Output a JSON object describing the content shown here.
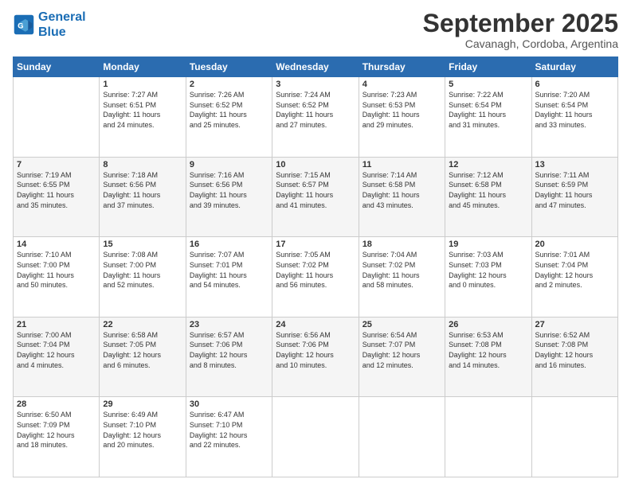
{
  "header": {
    "logo_line1": "General",
    "logo_line2": "Blue",
    "month": "September 2025",
    "location": "Cavanagh, Cordoba, Argentina"
  },
  "weekdays": [
    "Sunday",
    "Monday",
    "Tuesday",
    "Wednesday",
    "Thursday",
    "Friday",
    "Saturday"
  ],
  "weeks": [
    [
      {
        "day": "",
        "info": ""
      },
      {
        "day": "1",
        "info": "Sunrise: 7:27 AM\nSunset: 6:51 PM\nDaylight: 11 hours\nand 24 minutes."
      },
      {
        "day": "2",
        "info": "Sunrise: 7:26 AM\nSunset: 6:52 PM\nDaylight: 11 hours\nand 25 minutes."
      },
      {
        "day": "3",
        "info": "Sunrise: 7:24 AM\nSunset: 6:52 PM\nDaylight: 11 hours\nand 27 minutes."
      },
      {
        "day": "4",
        "info": "Sunrise: 7:23 AM\nSunset: 6:53 PM\nDaylight: 11 hours\nand 29 minutes."
      },
      {
        "day": "5",
        "info": "Sunrise: 7:22 AM\nSunset: 6:54 PM\nDaylight: 11 hours\nand 31 minutes."
      },
      {
        "day": "6",
        "info": "Sunrise: 7:20 AM\nSunset: 6:54 PM\nDaylight: 11 hours\nand 33 minutes."
      }
    ],
    [
      {
        "day": "7",
        "info": "Sunrise: 7:19 AM\nSunset: 6:55 PM\nDaylight: 11 hours\nand 35 minutes."
      },
      {
        "day": "8",
        "info": "Sunrise: 7:18 AM\nSunset: 6:56 PM\nDaylight: 11 hours\nand 37 minutes."
      },
      {
        "day": "9",
        "info": "Sunrise: 7:16 AM\nSunset: 6:56 PM\nDaylight: 11 hours\nand 39 minutes."
      },
      {
        "day": "10",
        "info": "Sunrise: 7:15 AM\nSunset: 6:57 PM\nDaylight: 11 hours\nand 41 minutes."
      },
      {
        "day": "11",
        "info": "Sunrise: 7:14 AM\nSunset: 6:58 PM\nDaylight: 11 hours\nand 43 minutes."
      },
      {
        "day": "12",
        "info": "Sunrise: 7:12 AM\nSunset: 6:58 PM\nDaylight: 11 hours\nand 45 minutes."
      },
      {
        "day": "13",
        "info": "Sunrise: 7:11 AM\nSunset: 6:59 PM\nDaylight: 11 hours\nand 47 minutes."
      }
    ],
    [
      {
        "day": "14",
        "info": "Sunrise: 7:10 AM\nSunset: 7:00 PM\nDaylight: 11 hours\nand 50 minutes."
      },
      {
        "day": "15",
        "info": "Sunrise: 7:08 AM\nSunset: 7:00 PM\nDaylight: 11 hours\nand 52 minutes."
      },
      {
        "day": "16",
        "info": "Sunrise: 7:07 AM\nSunset: 7:01 PM\nDaylight: 11 hours\nand 54 minutes."
      },
      {
        "day": "17",
        "info": "Sunrise: 7:05 AM\nSunset: 7:02 PM\nDaylight: 11 hours\nand 56 minutes."
      },
      {
        "day": "18",
        "info": "Sunrise: 7:04 AM\nSunset: 7:02 PM\nDaylight: 11 hours\nand 58 minutes."
      },
      {
        "day": "19",
        "info": "Sunrise: 7:03 AM\nSunset: 7:03 PM\nDaylight: 12 hours\nand 0 minutes."
      },
      {
        "day": "20",
        "info": "Sunrise: 7:01 AM\nSunset: 7:04 PM\nDaylight: 12 hours\nand 2 minutes."
      }
    ],
    [
      {
        "day": "21",
        "info": "Sunrise: 7:00 AM\nSunset: 7:04 PM\nDaylight: 12 hours\nand 4 minutes."
      },
      {
        "day": "22",
        "info": "Sunrise: 6:58 AM\nSunset: 7:05 PM\nDaylight: 12 hours\nand 6 minutes."
      },
      {
        "day": "23",
        "info": "Sunrise: 6:57 AM\nSunset: 7:06 PM\nDaylight: 12 hours\nand 8 minutes."
      },
      {
        "day": "24",
        "info": "Sunrise: 6:56 AM\nSunset: 7:06 PM\nDaylight: 12 hours\nand 10 minutes."
      },
      {
        "day": "25",
        "info": "Sunrise: 6:54 AM\nSunset: 7:07 PM\nDaylight: 12 hours\nand 12 minutes."
      },
      {
        "day": "26",
        "info": "Sunrise: 6:53 AM\nSunset: 7:08 PM\nDaylight: 12 hours\nand 14 minutes."
      },
      {
        "day": "27",
        "info": "Sunrise: 6:52 AM\nSunset: 7:08 PM\nDaylight: 12 hours\nand 16 minutes."
      }
    ],
    [
      {
        "day": "28",
        "info": "Sunrise: 6:50 AM\nSunset: 7:09 PM\nDaylight: 12 hours\nand 18 minutes."
      },
      {
        "day": "29",
        "info": "Sunrise: 6:49 AM\nSunset: 7:10 PM\nDaylight: 12 hours\nand 20 minutes."
      },
      {
        "day": "30",
        "info": "Sunrise: 6:47 AM\nSunset: 7:10 PM\nDaylight: 12 hours\nand 22 minutes."
      },
      {
        "day": "",
        "info": ""
      },
      {
        "day": "",
        "info": ""
      },
      {
        "day": "",
        "info": ""
      },
      {
        "day": "",
        "info": ""
      }
    ]
  ]
}
